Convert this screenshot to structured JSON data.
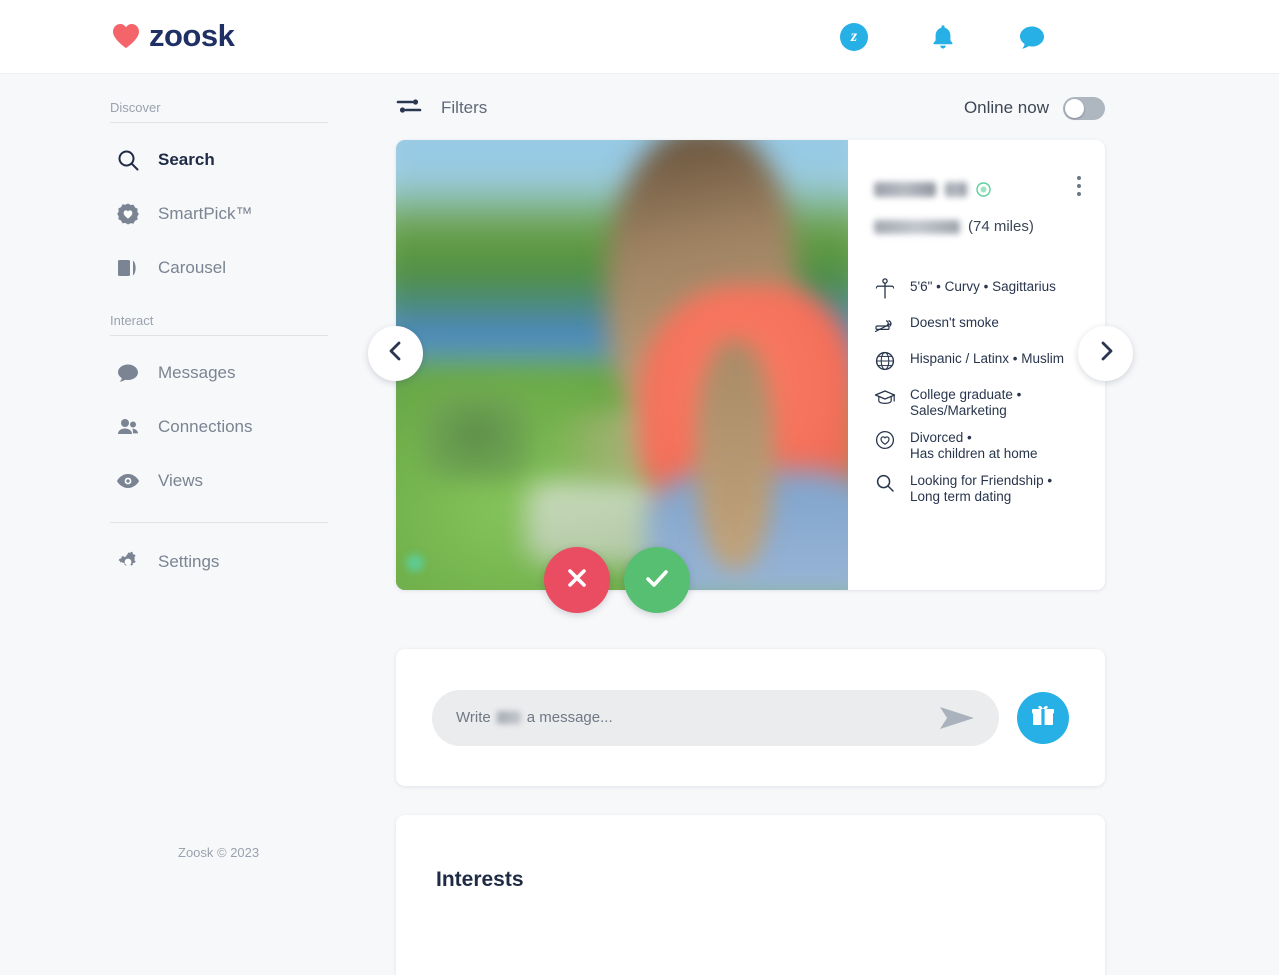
{
  "brand": {
    "name": "zoosk",
    "logo_icon": "heart-icon"
  },
  "header": {
    "icons": [
      {
        "name": "zoosk-coins-icon",
        "label": "z"
      },
      {
        "name": "notifications-bell-icon",
        "label": ""
      },
      {
        "name": "messages-chat-icon",
        "label": ""
      }
    ]
  },
  "sidebar": {
    "sections": [
      {
        "label": "Discover"
      },
      {
        "label": "Interact"
      }
    ],
    "discover_items": [
      {
        "label": "Search",
        "icon": "search-icon",
        "active": true
      },
      {
        "label": "SmartPick™",
        "icon": "smartpick-heart-icon",
        "active": false
      },
      {
        "label": "Carousel",
        "icon": "carousel-cards-icon",
        "active": false
      }
    ],
    "interact_items": [
      {
        "label": "Messages",
        "icon": "chat-bubble-icon",
        "active": false
      },
      {
        "label": "Connections",
        "icon": "people-icon",
        "active": false
      },
      {
        "label": "Views",
        "icon": "eye-icon",
        "active": false
      }
    ],
    "settings_item": {
      "label": "Settings",
      "icon": "gear-icon"
    },
    "footer": "Zoosk © 2023"
  },
  "toolbar": {
    "filters_label": "Filters",
    "filters_icon": "sliders-icon",
    "online_label": "Online now",
    "online_enabled": false
  },
  "profile": {
    "name_redacted": true,
    "verified_badge": "verified-icon",
    "location_redacted": true,
    "distance": "(74 miles)",
    "menu_icon": "more-options-icon",
    "attributes": [
      {
        "icon": "body-type-icon",
        "lines": [
          "5'6\" • Curvy • Sagittarius"
        ]
      },
      {
        "icon": "no-smoking-icon",
        "lines": [
          "Doesn't smoke"
        ]
      },
      {
        "icon": "globe-icon",
        "lines": [
          "Hispanic / Latinx • Muslim"
        ]
      },
      {
        "icon": "graduation-cap-icon",
        "lines": [
          "College graduate •",
          "Sales/Marketing"
        ]
      },
      {
        "icon": "heart-circle-icon",
        "lines": [
          "Divorced •",
          "Has children at home"
        ]
      },
      {
        "icon": "search-icon",
        "lines": [
          "Looking for Friendship •",
          "Long term dating"
        ]
      }
    ],
    "prev_icon": "chevron-left-icon",
    "next_icon": "chevron-right-icon",
    "pass_icon": "close-x-icon",
    "like_icon": "check-icon"
  },
  "composer": {
    "placeholder_prefix": "Write",
    "placeholder_suffix": "a message...",
    "send_icon": "send-arrow-icon",
    "gift_icon": "gift-icon"
  },
  "interests": {
    "title": "Interests"
  },
  "colors": {
    "brand_blue": "#27b0e6",
    "brand_navy": "#1f3164",
    "heart_red": "#f4656b",
    "pass_red": "#ea4c62",
    "like_green": "#56bf72",
    "verified_green": "#5bd0a0",
    "page_bg": "#f7f8fa"
  }
}
